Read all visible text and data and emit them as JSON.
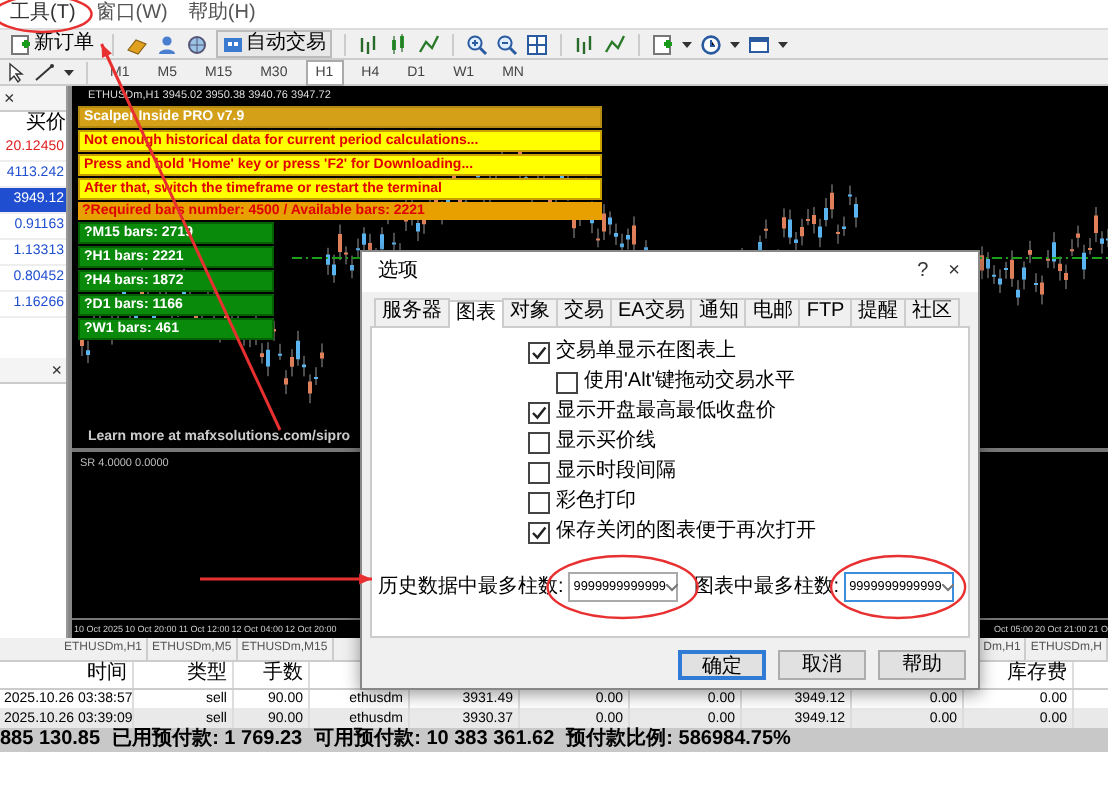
{
  "menu": [
    {
      "label": "工具(T)",
      "highlighted": true
    },
    {
      "label": "窗口(W)",
      "highlighted": false
    },
    {
      "label": "帮助(H)",
      "highlighted": false
    }
  ],
  "toolbar": {
    "new_order": "新订单",
    "auto_trading": "自动交易"
  },
  "timeframes": [
    {
      "label": "M1",
      "selected": false
    },
    {
      "label": "M5",
      "selected": false
    },
    {
      "label": "M15",
      "selected": false
    },
    {
      "label": "M30",
      "selected": false
    },
    {
      "label": "H1",
      "selected": true
    },
    {
      "label": "H4",
      "selected": false
    },
    {
      "label": "D1",
      "selected": false
    },
    {
      "label": "W1",
      "selected": false
    },
    {
      "label": "MN",
      "selected": false
    }
  ],
  "market_watch": {
    "close": "×",
    "column": "买价",
    "rows": [
      {
        "bid": "20.12450",
        "color": "#e02020",
        "selected": false
      },
      {
        "bid": "4113.242",
        "color": "#1f4fd0",
        "selected": false
      },
      {
        "bid": "3949.12",
        "color": "#1f4fd0",
        "selected": true
      },
      {
        "bid": "0.91163",
        "color": "#1f4fd0",
        "selected": false
      },
      {
        "bid": "1.13313",
        "color": "#1f4fd0",
        "selected": false
      },
      {
        "bid": "0.80452",
        "color": "#1f4fd0",
        "selected": false
      },
      {
        "bid": "1.16266",
        "color": "#1f4fd0",
        "selected": false
      }
    ]
  },
  "navigator": {
    "close": "×"
  },
  "chart": {
    "title": "ETHUSDm,H1  3945.02 3950.38 3940.76 3947.72",
    "info_lines": [
      {
        "kind": "title",
        "text": "Scalper Inside PRO v7.9"
      },
      {
        "kind": "warning",
        "text": "Not enough historical data for current period calculations..."
      },
      {
        "kind": "warning",
        "text": "Press and hold 'Home' key or press 'F2' for Downloading..."
      },
      {
        "kind": "warning",
        "text": "After that, switch the timeframe or restart the terminal"
      },
      {
        "kind": "required",
        "text": "?Required bars number: 4500 / Available bars: 2221"
      },
      {
        "kind": "count",
        "text": "?M15 bars: 2719"
      },
      {
        "kind": "count",
        "text": "?H1 bars: 2221"
      },
      {
        "kind": "count",
        "text": "?H4 bars: 1872"
      },
      {
        "kind": "count",
        "text": "?D1 bars: 1166"
      },
      {
        "kind": "count",
        "text": "?W1 bars: 461"
      }
    ],
    "footer_link": "Learn more at mafxsolutions.com/sipro",
    "subwindow_label": "SR 4.0000 0.0000",
    "time_axis_left": [
      "10 Oct 2025",
      "10 Oct 20:00",
      "11 Oct 12:00",
      "12 Oct 04:00",
      "12 Oct 20:00"
    ],
    "time_axis_right": [
      "Oct 05:00",
      "20 Oct 21:00",
      "21 O"
    ]
  },
  "chart_tabs_left": [
    "ETHUSDm,H1",
    "ETHUSDm,M5",
    "ETHUSDm,M15"
  ],
  "chart_tabs_right": [
    "Dm,H1",
    "ETHUSDm,H"
  ],
  "trades": {
    "columns": {
      "time": "时间",
      "type": "类型",
      "volume": "手数",
      "swap": "库存费"
    },
    "rows": [
      [
        "2025.10.26 03:38:57",
        "sell",
        "90.00",
        "ethusdm",
        "3931.49",
        "0.00",
        "0.00",
        "3949.12",
        "0.00",
        "0.00"
      ],
      [
        "2025.10.26 03:39:09",
        "sell",
        "90.00",
        "ethusdm",
        "3930.37",
        "0.00",
        "0.00",
        "3949.12",
        "0.00",
        "0.00"
      ]
    ]
  },
  "status_bar": [
    "885 130.85",
    "已用预付款: 1 769.23",
    "可用预付款: 10 383 361.62",
    "预付款比例: 586984.75%"
  ],
  "dialog": {
    "title": "选项",
    "help": "?",
    "close": "×",
    "tabs": [
      {
        "label": "服务器",
        "selected": false
      },
      {
        "label": "图表",
        "selected": true
      },
      {
        "label": "对象",
        "selected": false
      },
      {
        "label": "交易",
        "selected": false
      },
      {
        "label": "EA交易",
        "selected": false
      },
      {
        "label": "通知",
        "selected": false
      },
      {
        "label": "电邮",
        "selected": false
      },
      {
        "label": "FTP",
        "selected": false
      },
      {
        "label": "提醒",
        "selected": false
      },
      {
        "label": "社区",
        "selected": false
      }
    ],
    "options": [
      {
        "label": "交易单显示在图表上",
        "checked": true,
        "children": [
          {
            "label": "使用'Alt'键拖动交易水平",
            "checked": false
          }
        ]
      },
      {
        "label": "显示开盘最高最低收盘价",
        "checked": true
      },
      {
        "label": "显示买价线",
        "checked": false
      },
      {
        "label": "显示时段间隔",
        "checked": false
      },
      {
        "label": "彩色打印",
        "checked": false
      },
      {
        "label": "保存关闭的图表便于再次打开",
        "checked": true
      }
    ],
    "fields": [
      {
        "label": "历史数据中最多柱数:",
        "value": "9999999999999",
        "focused": false
      },
      {
        "label": "图表中最多柱数:",
        "value": "9999999999999",
        "focused": true
      }
    ],
    "buttons": [
      {
        "label": "确定",
        "default": true
      },
      {
        "label": "取消",
        "default": false
      },
      {
        "label": "帮助",
        "default": false
      }
    ]
  }
}
